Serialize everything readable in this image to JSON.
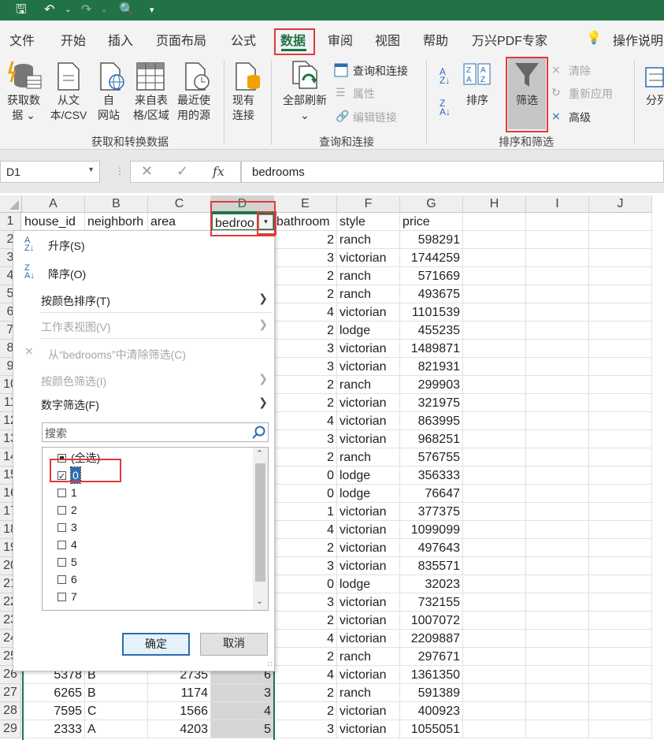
{
  "ribbon_tabs": [
    "文件",
    "开始",
    "插入",
    "页面布局",
    "公式",
    "数据",
    "审阅",
    "视图",
    "帮助",
    "万兴PDF专家"
  ],
  "active_tab": "数据",
  "tell_me": "操作说明",
  "ribbon": {
    "get_data": [
      "获取数",
      "据 ⌄"
    ],
    "from_csv": [
      "从文",
      "本/CSV"
    ],
    "from_web": [
      "自",
      "网站"
    ],
    "from_table": [
      "来自表",
      "格/区域"
    ],
    "recent": [
      "最近使",
      "用的源"
    ],
    "existing": [
      "现有",
      "连接"
    ],
    "group_get": "获取和转换数据",
    "refresh_all": [
      "全部刷新",
      "⌄"
    ],
    "queries": "查询和连接",
    "properties": "属性",
    "edit_links": "编辑链接",
    "group_queries": "查询和连接",
    "sort": "排序",
    "filter": "筛选",
    "clear": "清除",
    "reapply": "重新应用",
    "advanced": "高级",
    "group_sort": "排序和筛选",
    "split": "分列"
  },
  "namebox": "D1",
  "formula": "bedrooms",
  "columns": [
    "A",
    "B",
    "C",
    "D",
    "E",
    "F",
    "G",
    "H",
    "I",
    "J"
  ],
  "headers": [
    "house_id",
    "neighborh",
    "area",
    "bedroo",
    "bathroom",
    "style",
    "price"
  ],
  "rows": [
    {
      "r": "2",
      "e": "2",
      "f": "ranch",
      "g": "598291"
    },
    {
      "r": "3",
      "e": "3",
      "f": "victorian",
      "g": "1744259"
    },
    {
      "r": "4",
      "e": "2",
      "f": "ranch",
      "g": "571669"
    },
    {
      "r": "5",
      "e": "2",
      "f": "ranch",
      "g": "493675"
    },
    {
      "r": "6",
      "e": "4",
      "f": "victorian",
      "g": "1101539"
    },
    {
      "r": "7",
      "e": "2",
      "f": "lodge",
      "g": "455235"
    },
    {
      "r": "8",
      "e": "3",
      "f": "victorian",
      "g": "1489871"
    },
    {
      "r": "9",
      "e": "3",
      "f": "victorian",
      "g": "821931"
    },
    {
      "r": "10",
      "e": "2",
      "f": "ranch",
      "g": "299903"
    },
    {
      "r": "11",
      "e": "2",
      "f": "victorian",
      "g": "321975"
    },
    {
      "r": "12",
      "e": "4",
      "f": "victorian",
      "g": "863995"
    },
    {
      "r": "13",
      "e": "3",
      "f": "victorian",
      "g": "968251"
    },
    {
      "r": "14",
      "e": "2",
      "f": "ranch",
      "g": "576755"
    },
    {
      "r": "15",
      "e": "0",
      "f": "lodge",
      "g": "356333"
    },
    {
      "r": "16",
      "e": "0",
      "f": "lodge",
      "g": "76647"
    },
    {
      "r": "17",
      "e": "1",
      "f": "victorian",
      "g": "377375"
    },
    {
      "r": "18",
      "e": "4",
      "f": "victorian",
      "g": "1099099"
    },
    {
      "r": "19",
      "e": "2",
      "f": "victorian",
      "g": "497643"
    },
    {
      "r": "20",
      "e": "3",
      "f": "victorian",
      "g": "835571"
    },
    {
      "r": "21",
      "e": "0",
      "f": "lodge",
      "g": "32023"
    },
    {
      "r": "22",
      "e": "3",
      "f": "victorian",
      "g": "732155"
    },
    {
      "r": "23",
      "e": "2",
      "f": "victorian",
      "g": "1007072"
    },
    {
      "r": "24",
      "e": "4",
      "f": "victorian",
      "g": "2209887"
    },
    {
      "r": "25",
      "e": "2",
      "f": "ranch",
      "g": "297671"
    },
    {
      "r": "26",
      "a": "5378",
      "b": "B",
      "c": "2735",
      "d": "6",
      "e": "4",
      "f": "victorian",
      "g": "1361350"
    },
    {
      "r": "27",
      "a": "6265",
      "b": "B",
      "c": "1174",
      "d": "3",
      "e": "2",
      "f": "ranch",
      "g": "591389"
    },
    {
      "r": "28",
      "a": "7595",
      "b": "C",
      "c": "1566",
      "d": "4",
      "e": "2",
      "f": "victorian",
      "g": "400923"
    },
    {
      "r": "29",
      "a": "2333",
      "b": "A",
      "c": "4203",
      "d": "5",
      "e": "3",
      "f": "victorian",
      "g": "1055051"
    }
  ],
  "menu": {
    "sort_asc": "升序(S)",
    "sort_desc": "降序(O)",
    "sort_color": "按颜色排序(T)",
    "sheet_view": "工作表视图(V)",
    "clear_filter": "从“bedrooms”中清除筛选(C)",
    "filter_color": "按颜色筛选(I)",
    "number_filter": "数字筛选(F)",
    "search_placeholder": "搜索",
    "items": [
      {
        "label": "(全选)",
        "state": "partial"
      },
      {
        "label": "0",
        "state": "checked"
      },
      {
        "label": "1",
        "state": "unchecked"
      },
      {
        "label": "2",
        "state": "unchecked"
      },
      {
        "label": "3",
        "state": "unchecked"
      },
      {
        "label": "4",
        "state": "unchecked"
      },
      {
        "label": "5",
        "state": "unchecked"
      },
      {
        "label": "6",
        "state": "unchecked"
      },
      {
        "label": "7",
        "state": "unchecked"
      },
      {
        "label": "8",
        "state": "unchecked"
      }
    ],
    "ok": "确定",
    "cancel": "取消"
  }
}
